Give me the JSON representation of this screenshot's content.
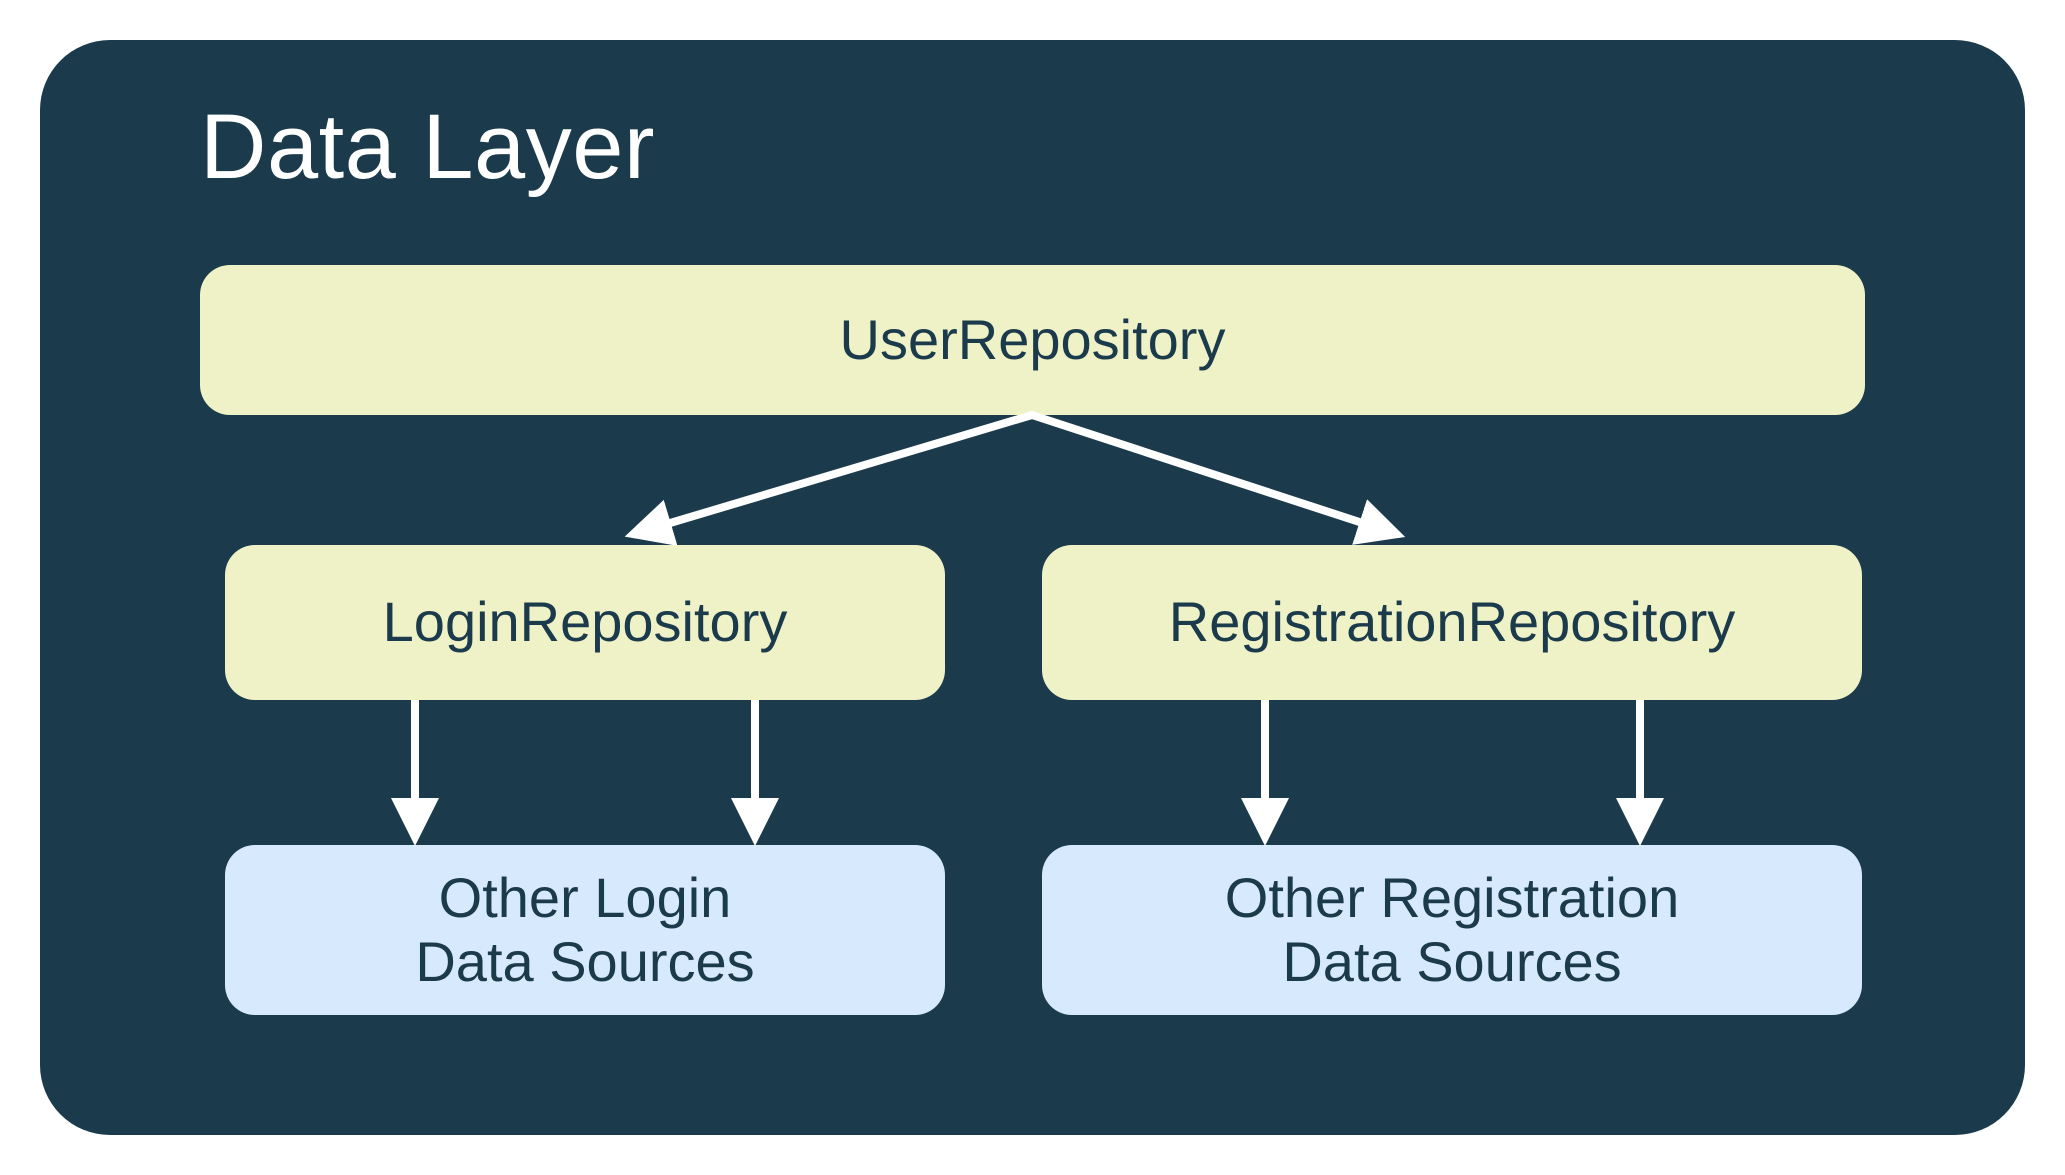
{
  "title": "Data Layer",
  "nodes": {
    "userRepository": "UserRepository",
    "loginRepository": "LoginRepository",
    "registrationRepository": "RegistrationRepository",
    "loginSourcesLine1": "Other Login",
    "loginSourcesLine2": "Data Sources",
    "registrationSourcesLine1": "Other Registration",
    "registrationSourcesLine2": "Data Sources"
  },
  "colors": {
    "panel": "#1b3a4b",
    "nodeYellow": "#eef2c6",
    "nodeBlue": "#d7eafd",
    "arrow": "#ffffff",
    "titleText": "#ffffff",
    "nodeText": "#1b3a4b"
  }
}
